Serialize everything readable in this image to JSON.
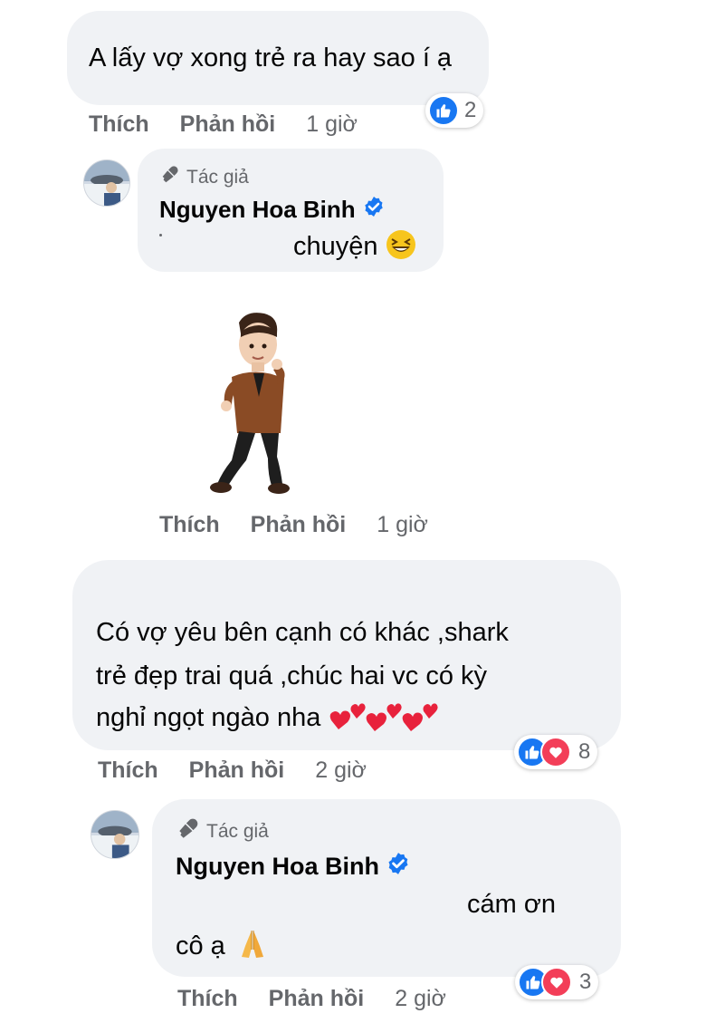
{
  "comments": [
    {
      "text": "A lấy vợ xong trẻ ra hay sao í ạ",
      "actions": {
        "like": "Thích",
        "reply": "Phản hồi",
        "time": "1 giờ"
      },
      "reaction_count": "2"
    },
    {
      "author_badge": "Tác giả",
      "author_name": "Nguyen Hoa Binh",
      "text": "chuyện",
      "emoji": "laughing-emoji",
      "sticker": "avatar-sticker",
      "actions": {
        "like": "Thích",
        "reply": "Phản hồi",
        "time": "1 giờ"
      }
    },
    {
      "text_lines": [
        "Có vợ yêu bên cạnh có khác ,shark",
        "trẻ đẹp trai quá ,chúc hai vc có kỳ",
        "nghỉ ngọt ngào nha"
      ],
      "emoji": "hearts-emoji",
      "actions": {
        "like": "Thích",
        "reply": "Phản hồi",
        "time": "2 giờ"
      },
      "reaction_count": "8"
    },
    {
      "author_badge": "Tác giả",
      "author_name": "Nguyen Hoa Binh",
      "text_line1": "cám ơn",
      "text_line2": "cô ạ",
      "emoji": "pray-emoji",
      "actions": {
        "like": "Thích",
        "reply": "Phản hồi",
        "time": "2 giờ"
      },
      "reaction_count": "3"
    }
  ],
  "colors": {
    "bubble": "#f0f2f5",
    "meta": "#65676b",
    "like": "#1877f2",
    "love": "#f33e58",
    "verified": "#1877f2"
  }
}
